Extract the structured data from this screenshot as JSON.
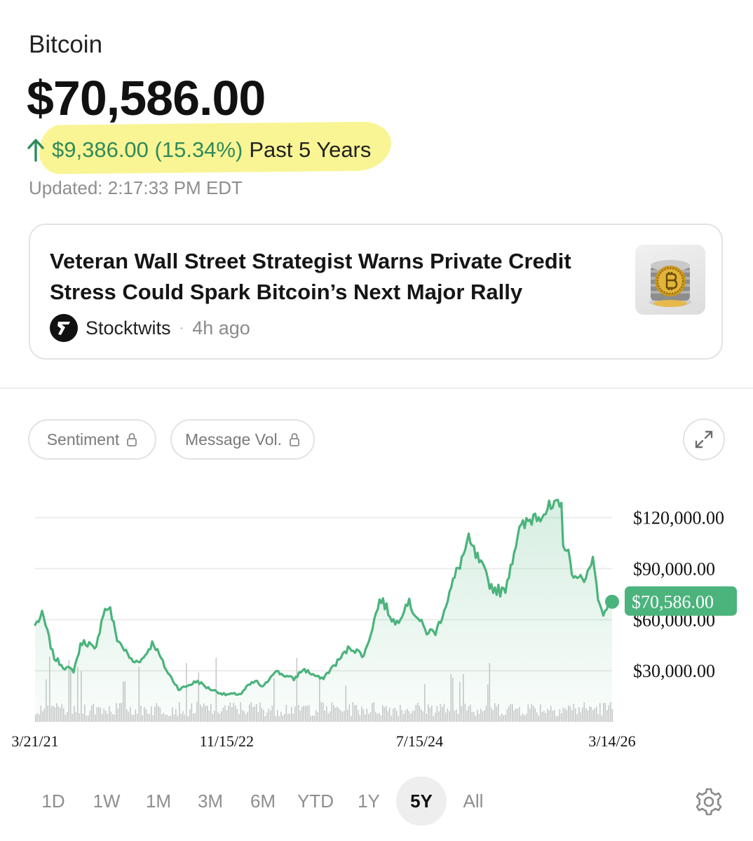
{
  "asset": {
    "name": "Bitcoin",
    "price": "$70,586.00",
    "change": "$9,386.00 (15.34%)",
    "period": "Past 5 Years",
    "updated": "Updated: 2:17:33 PM EDT"
  },
  "news": {
    "headline": "Veteran Wall Street Strategist Warns Private Credit Stress Could Spark Bitcoin’s Next Major Rally",
    "source": "Stocktwits",
    "separator": "·",
    "age": "4h ago"
  },
  "toolbar": {
    "sentiment_label": "Sentiment",
    "message_volume_label": "Message Vol."
  },
  "icons": {
    "change_arrow": "arrow-up-icon",
    "lock": "lock-icon",
    "expand": "expand-icon",
    "settings": "gear-icon",
    "source_logo": "stocktwits-logo-icon"
  },
  "colors": {
    "accent_green": "#2f8a5b",
    "line_green": "#4bb37c",
    "highlight": "#f8f488",
    "volume_gray": "#c9c9c9"
  },
  "chart_data": {
    "type": "area",
    "xlabel": "",
    "ylabel": "",
    "ylim": [
      0,
      140000
    ],
    "yticks": [
      {
        "value": 30000,
        "label": "$30,000.00"
      },
      {
        "value": 60000,
        "label": "$60,000.00"
      },
      {
        "value": 90000,
        "label": "$90,000.00"
      },
      {
        "value": 120000,
        "label": "$120,000.00"
      }
    ],
    "xticks": [
      {
        "date": "2021-03-21",
        "label": "3/21/21"
      },
      {
        "date": "2022-11-15",
        "label": "11/15/22"
      },
      {
        "date": "2024-07-15",
        "label": "7/15/24"
      },
      {
        "date": "2026-03-14",
        "label": "3/14/26"
      }
    ],
    "current_value_label": "$70,586.00",
    "current_value": 70586,
    "grid": true,
    "series": [
      {
        "points": [
          [
            "2021-03-21",
            57000
          ],
          [
            "2021-04-14",
            63000
          ],
          [
            "2021-05-19",
            38000
          ],
          [
            "2021-06-22",
            32000
          ],
          [
            "2021-07-20",
            30000
          ],
          [
            "2021-08-15",
            47000
          ],
          [
            "2021-09-08",
            46000
          ],
          [
            "2021-09-28",
            41000
          ],
          [
            "2021-10-20",
            64000
          ],
          [
            "2021-11-10",
            68000
          ],
          [
            "2021-12-04",
            49000
          ],
          [
            "2022-01-24",
            35000
          ],
          [
            "2022-02-24",
            37000
          ],
          [
            "2022-03-28",
            47000
          ],
          [
            "2022-05-10",
            30000
          ],
          [
            "2022-06-18",
            19000
          ],
          [
            "2022-08-15",
            24000
          ],
          [
            "2022-09-15",
            20000
          ],
          [
            "2022-11-09",
            16000
          ],
          [
            "2022-12-31",
            16500
          ],
          [
            "2023-01-20",
            21000
          ],
          [
            "2023-02-15",
            24000
          ],
          [
            "2023-03-10",
            20000
          ],
          [
            "2023-04-14",
            30000
          ],
          [
            "2023-06-15",
            25000
          ],
          [
            "2023-07-14",
            31000
          ],
          [
            "2023-09-11",
            25000
          ],
          [
            "2023-10-24",
            34000
          ],
          [
            "2023-12-08",
            44000
          ],
          [
            "2024-01-23",
            39000
          ],
          [
            "2024-03-14",
            73000
          ],
          [
            "2024-05-01",
            57000
          ],
          [
            "2024-06-07",
            71000
          ],
          [
            "2024-08-05",
            53000
          ],
          [
            "2024-09-06",
            53000
          ],
          [
            "2024-11-13",
            90000
          ],
          [
            "2024-12-17",
            106000
          ],
          [
            "2025-02-28",
            79000
          ],
          [
            "2025-04-08",
            76000
          ],
          [
            "2025-05-22",
            111000
          ],
          [
            "2025-07-14",
            122000
          ],
          [
            "2025-08-13",
            124000
          ],
          [
            "2025-10-06",
            126000
          ],
          [
            "2025-10-10",
            108000
          ],
          [
            "2025-11-21",
            82000
          ],
          [
            "2025-12-31",
            88000
          ],
          [
            "2026-01-14",
            97000
          ],
          [
            "2026-02-06",
            63000
          ],
          [
            "2026-03-14",
            70586
          ]
        ]
      }
    ]
  }
}
